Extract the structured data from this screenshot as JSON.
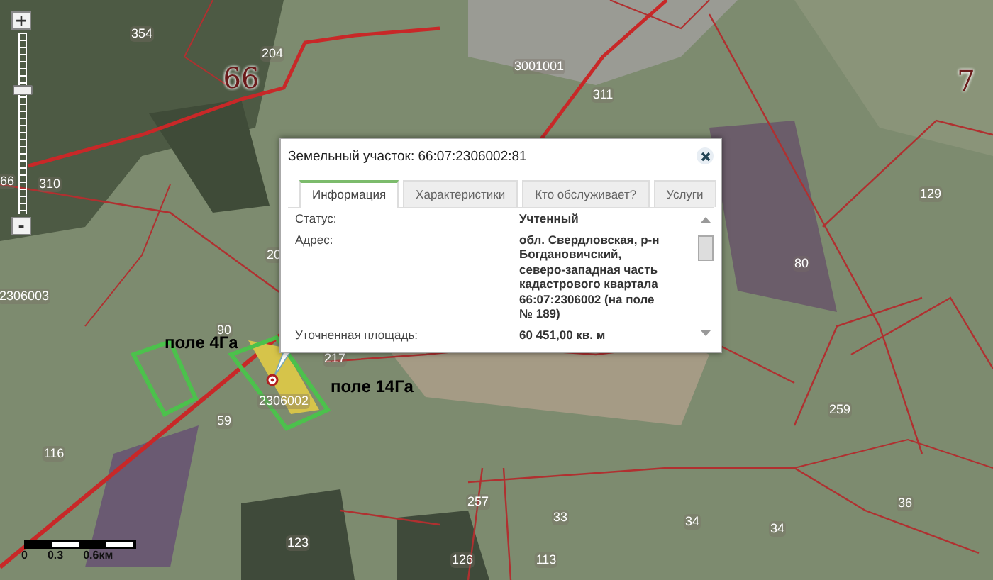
{
  "map": {
    "labels": [
      {
        "text": "354",
        "kind": "parcel"
      },
      {
        "text": "204",
        "kind": "parcel"
      },
      {
        "text": "66",
        "kind": "district"
      },
      {
        "text": "3001001",
        "kind": "parcel"
      },
      {
        "text": "311",
        "kind": "parcel"
      },
      {
        "text": "7",
        "kind": "district"
      },
      {
        "text": "129",
        "kind": "parcel"
      },
      {
        "text": "80",
        "kind": "parcel"
      },
      {
        "text": "310",
        "kind": "parcel"
      },
      {
        "text": "66",
        "kind": "parcel"
      },
      {
        "text": "2306003",
        "kind": "parcel"
      },
      {
        "text": "20",
        "kind": "parcel"
      },
      {
        "text": "90",
        "kind": "parcel"
      },
      {
        "text": "217",
        "kind": "parcel"
      },
      {
        "text": "2306002",
        "kind": "parcel"
      },
      {
        "text": "59",
        "kind": "parcel"
      },
      {
        "text": "116",
        "kind": "parcel"
      },
      {
        "text": "123",
        "kind": "parcel"
      },
      {
        "text": "257",
        "kind": "parcel"
      },
      {
        "text": "126",
        "kind": "parcel"
      },
      {
        "text": "259",
        "kind": "parcel"
      },
      {
        "text": "33",
        "kind": "parcel"
      },
      {
        "text": "34",
        "kind": "parcel"
      },
      {
        "text": "34",
        "kind": "parcel"
      },
      {
        "text": "36",
        "kind": "parcel"
      },
      {
        "text": "113",
        "kind": "parcel"
      },
      {
        "text": "поле 4Га",
        "kind": "annotation"
      },
      {
        "text": "поле 14Га",
        "kind": "annotation"
      }
    ]
  },
  "zoom_control": {
    "plus": "+",
    "minus": "-",
    "level": 0.7
  },
  "scale_bar": {
    "labels": [
      "0",
      "0.3",
      "0.6км"
    ]
  },
  "popup": {
    "title": "Земельный участок: 66:07:2306002:81",
    "tabs": [
      {
        "label": "Информация",
        "selected": true
      },
      {
        "label": "Характеристики",
        "selected": false
      },
      {
        "label": "Кто обслуживает?",
        "selected": false
      },
      {
        "label": "Услуги",
        "selected": false
      }
    ],
    "fields": [
      {
        "label": "Статус:",
        "value": "Учтенный"
      },
      {
        "label": "Адрес:",
        "value": "обл. Свердловская, р-н Богдановичский, северо-западная часть кадастрового квартала 66:07:2306002 (на поле № 189)"
      },
      {
        "label": "Уточненная площадь:",
        "value": "60 451,00 кв. м"
      }
    ]
  }
}
